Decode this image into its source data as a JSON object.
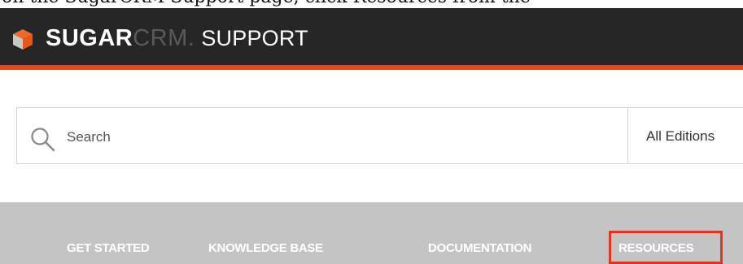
{
  "caption": {
    "text": "on the SugarCRM Support page, click Resources from the"
  },
  "header": {
    "brand_sugar": "SUGAR",
    "brand_crm": "CRM",
    "brand_dot": ".",
    "brand_support": "SUPPORT",
    "accent_color": "#e0491b",
    "background_color": "#262626"
  },
  "search": {
    "placeholder": "Search",
    "edition_filter": "All Editions",
    "icon": "search-icon"
  },
  "nav": {
    "items": [
      {
        "label": "GET STARTED"
      },
      {
        "label": "KNOWLEDGE BASE"
      },
      {
        "label": "DOCUMENTATION"
      },
      {
        "label": "RESOURCES",
        "highlighted": true
      }
    ],
    "background_color": "#c4c4c4",
    "highlight_color": "#e8321e"
  }
}
